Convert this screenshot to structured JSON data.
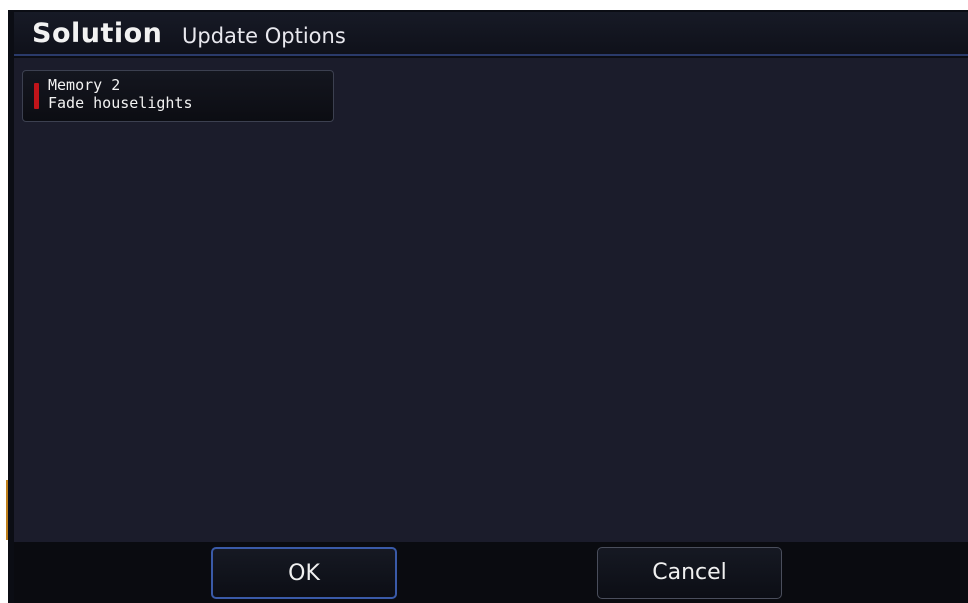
{
  "window": {
    "brand": "Solution",
    "title": "Update Options"
  },
  "memory_item": {
    "line1": "Memory 2",
    "line2": "Fade houselights",
    "marker_color": "#c0141a"
  },
  "footer": {
    "ok_label": "OK",
    "cancel_label": "Cancel"
  },
  "colors": {
    "background": "#1b1c2b",
    "title_bar": "#0f111a",
    "accent_blue": "#3a5aa8"
  }
}
